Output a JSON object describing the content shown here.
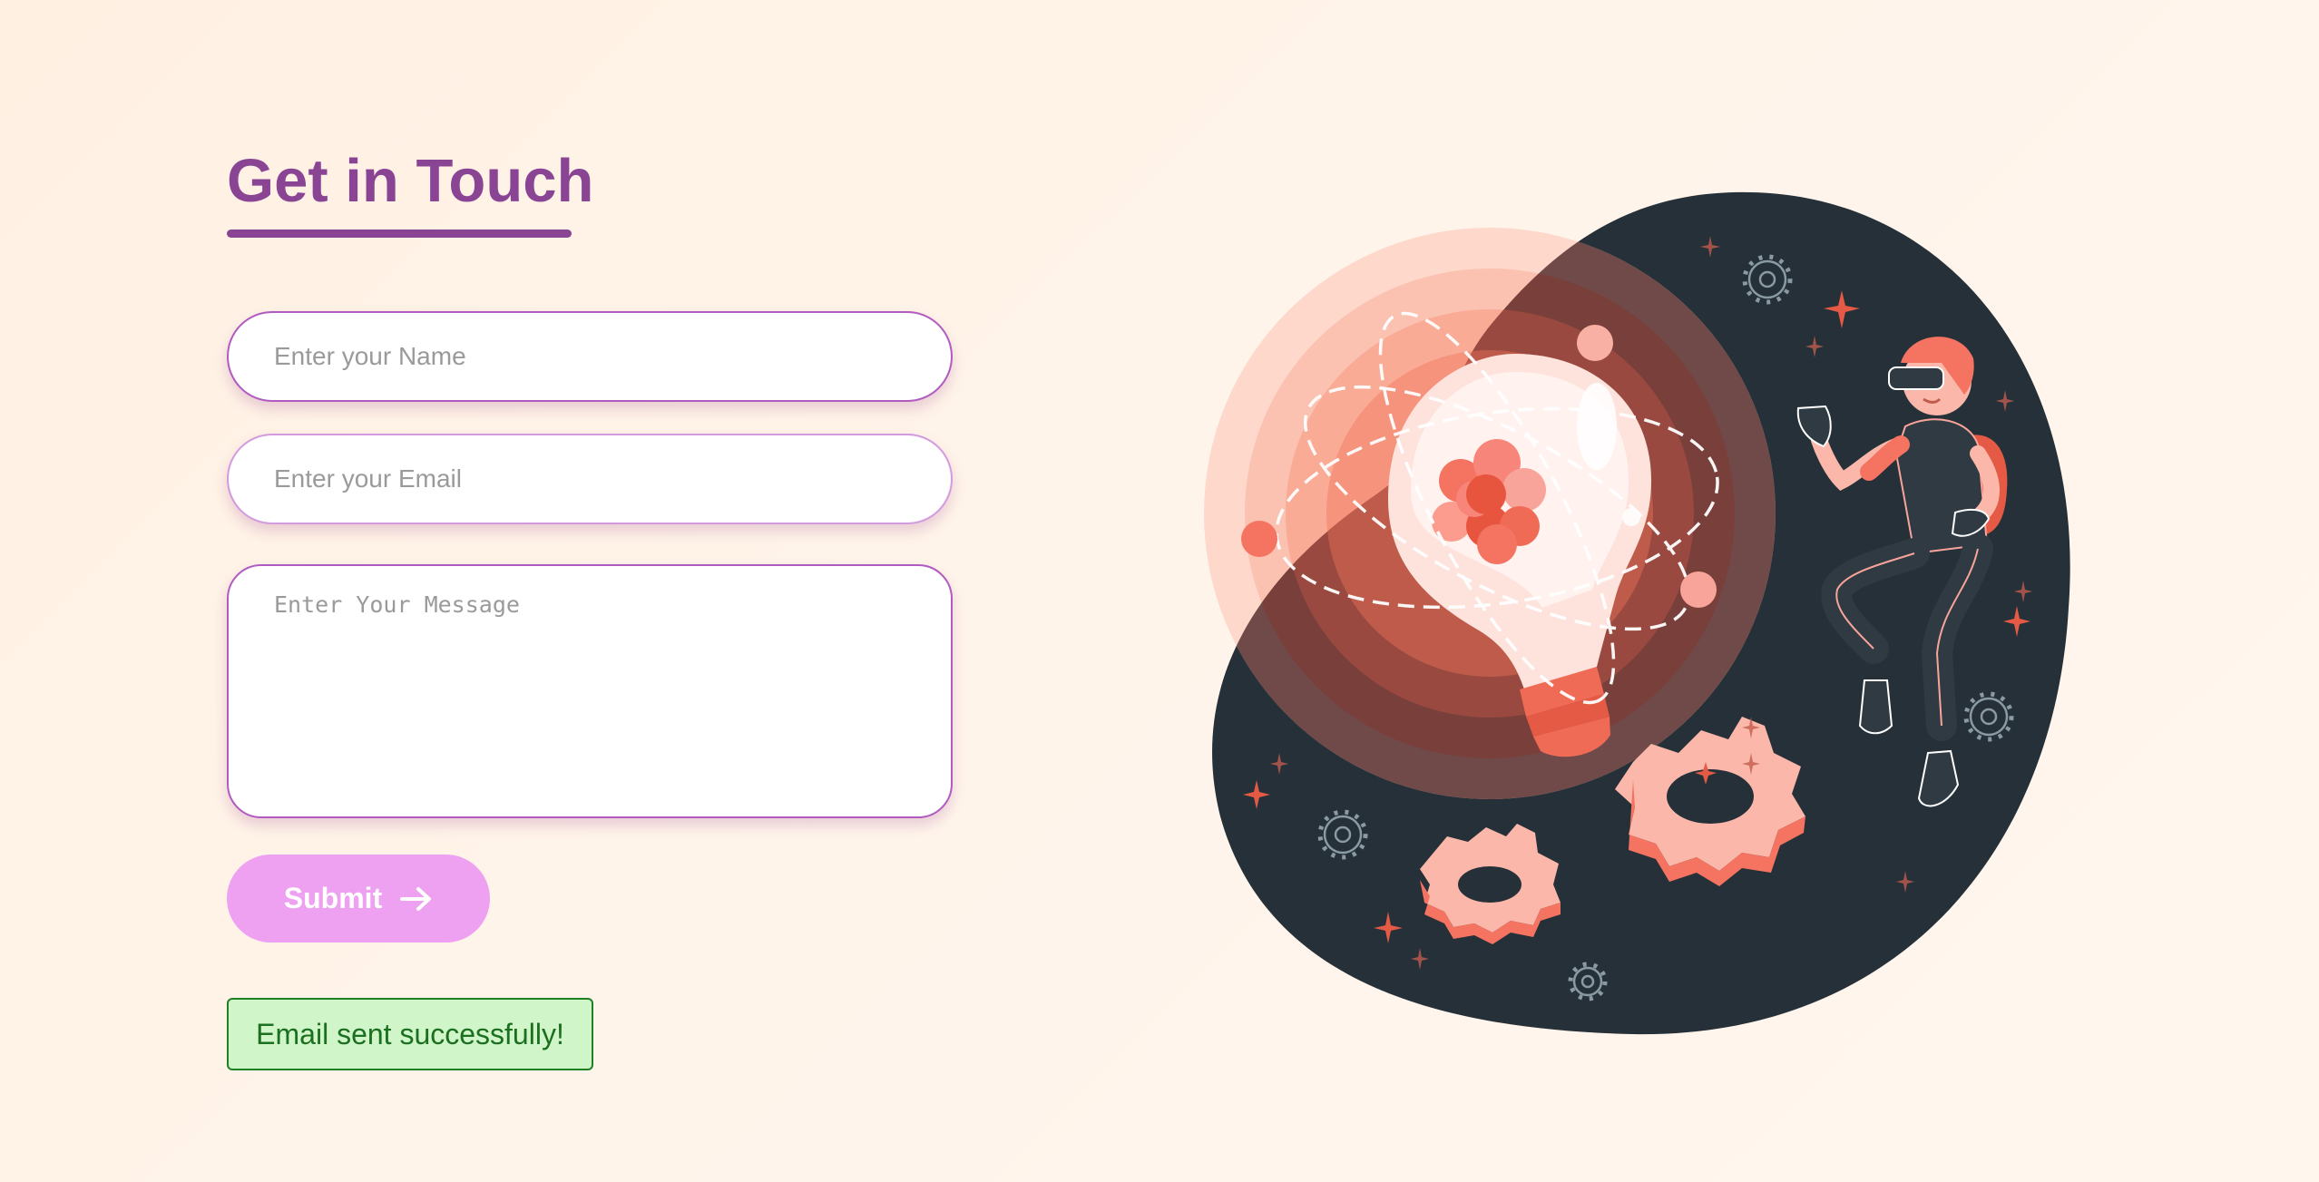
{
  "form": {
    "title": "Get in Touch",
    "name_placeholder": "Enter your Name",
    "email_placeholder": "Enter your Email",
    "message_placeholder": "Enter Your Message",
    "name_value": "",
    "email_value": "",
    "message_value": "",
    "submit_label": "Submit",
    "submit_icon": "arrow-right-icon"
  },
  "alert": {
    "text": "Email sent successfully!",
    "status": "success"
  },
  "illustration": {
    "subject": "person with VR headset floating beside a glowing light bulb with an atom and gears"
  },
  "colors": {
    "accent": "#8a4494",
    "input_border": "#b15bc0",
    "button_bg": "#eea0f1",
    "success_bg": "#cff5c9",
    "success_border": "#1f7f24",
    "illustration_dark": "#263038",
    "illustration_coral": "#f47361"
  }
}
